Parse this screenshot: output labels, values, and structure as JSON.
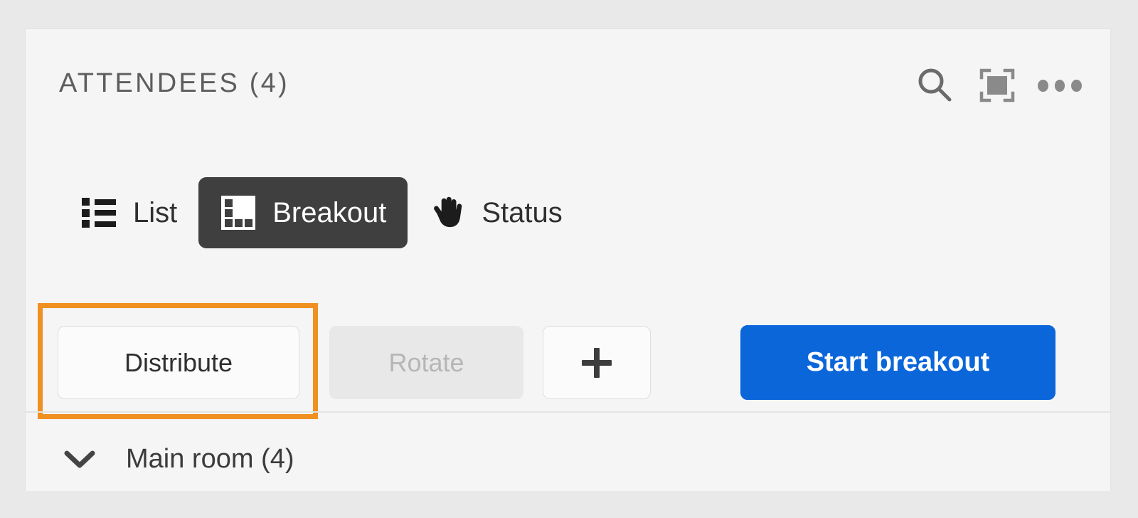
{
  "panel": {
    "header": {
      "title": "ATTENDEES  (4)",
      "actions": [
        {
          "name": "search-icon",
          "label": "Search"
        },
        {
          "name": "focus-icon",
          "label": "Focus"
        },
        {
          "name": "more-options-icon",
          "label": "More options"
        }
      ]
    },
    "tabs": [
      {
        "id": "list",
        "label": "List",
        "icon": "list-icon",
        "active": false
      },
      {
        "id": "breakout",
        "label": "Breakout",
        "icon": "grid-icon",
        "active": true
      },
      {
        "id": "status",
        "label": "Status",
        "icon": "raised-hand-icon",
        "active": false
      }
    ],
    "actions": {
      "distribute_label": "Distribute",
      "rotate_label": "Rotate",
      "add_label": "+",
      "start_label": "Start breakout",
      "rotate_disabled": true,
      "highlighted": "distribute"
    },
    "rooms": [
      {
        "label": "Main room (4)",
        "expanded": true
      }
    ]
  },
  "colors": {
    "highlight": "#ef9021",
    "primary": "#0b66da",
    "active_tab_bg": "#3f3f3f",
    "page_bg": "#e9e9e9",
    "panel_bg": "#f5f5f5",
    "disabled_text": "#b6b6b6"
  }
}
